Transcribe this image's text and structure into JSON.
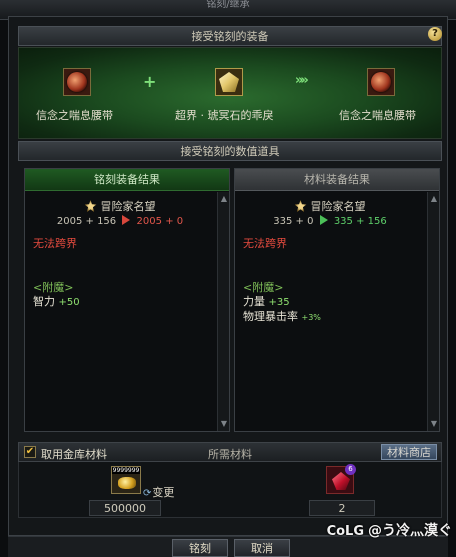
{
  "window": {
    "title": "铭刻/继承"
  },
  "equip_section": {
    "title": "接受铭刻的装备",
    "help_label": "?",
    "source_item": "信念之喘息腰带",
    "material_item": "超界 · 琥冥石的乖戾",
    "result_item": "信念之喘息腰带",
    "plus_symbol": "+",
    "arrow_symbol": "»»"
  },
  "values_section": {
    "title": "接受铭刻的数值道具"
  },
  "engrave_result": {
    "header": "铭刻装备结果",
    "reputation_label": "冒险家名望",
    "before_base": "2005",
    "before_bonus": "+ 156",
    "after_base": "2005",
    "after_bonus": "+ 0",
    "warning": "无法跨界",
    "enchant_title": "<附魔>",
    "stats": [
      {
        "name": "智力",
        "value": "+50"
      }
    ]
  },
  "material_result": {
    "header": "材料装备结果",
    "reputation_label": "冒险家名望",
    "before_base": "335",
    "before_bonus": "+ 0",
    "after_base": "335",
    "after_bonus": "+ 156",
    "warning": "无法跨界",
    "enchant_title": "<附魔>",
    "stats": [
      {
        "name": "力量",
        "value": "+35"
      },
      {
        "name": "物理暴击率",
        "value": "+3%"
      }
    ]
  },
  "materials": {
    "use_vault_label": "取用金库材料",
    "use_vault_checked": true,
    "title": "所需材料",
    "shop_button": "材料商店",
    "gold_stack_label": "9999999",
    "change_label": "变更",
    "gold_amount": "500000",
    "gem_badge": "6",
    "gem_amount": "2"
  },
  "footer": {
    "confirm": "铭刻",
    "cancel": "取消"
  },
  "watermark": {
    "logo": "CoLG",
    "text": "@う冷灬漠ぐ"
  }
}
